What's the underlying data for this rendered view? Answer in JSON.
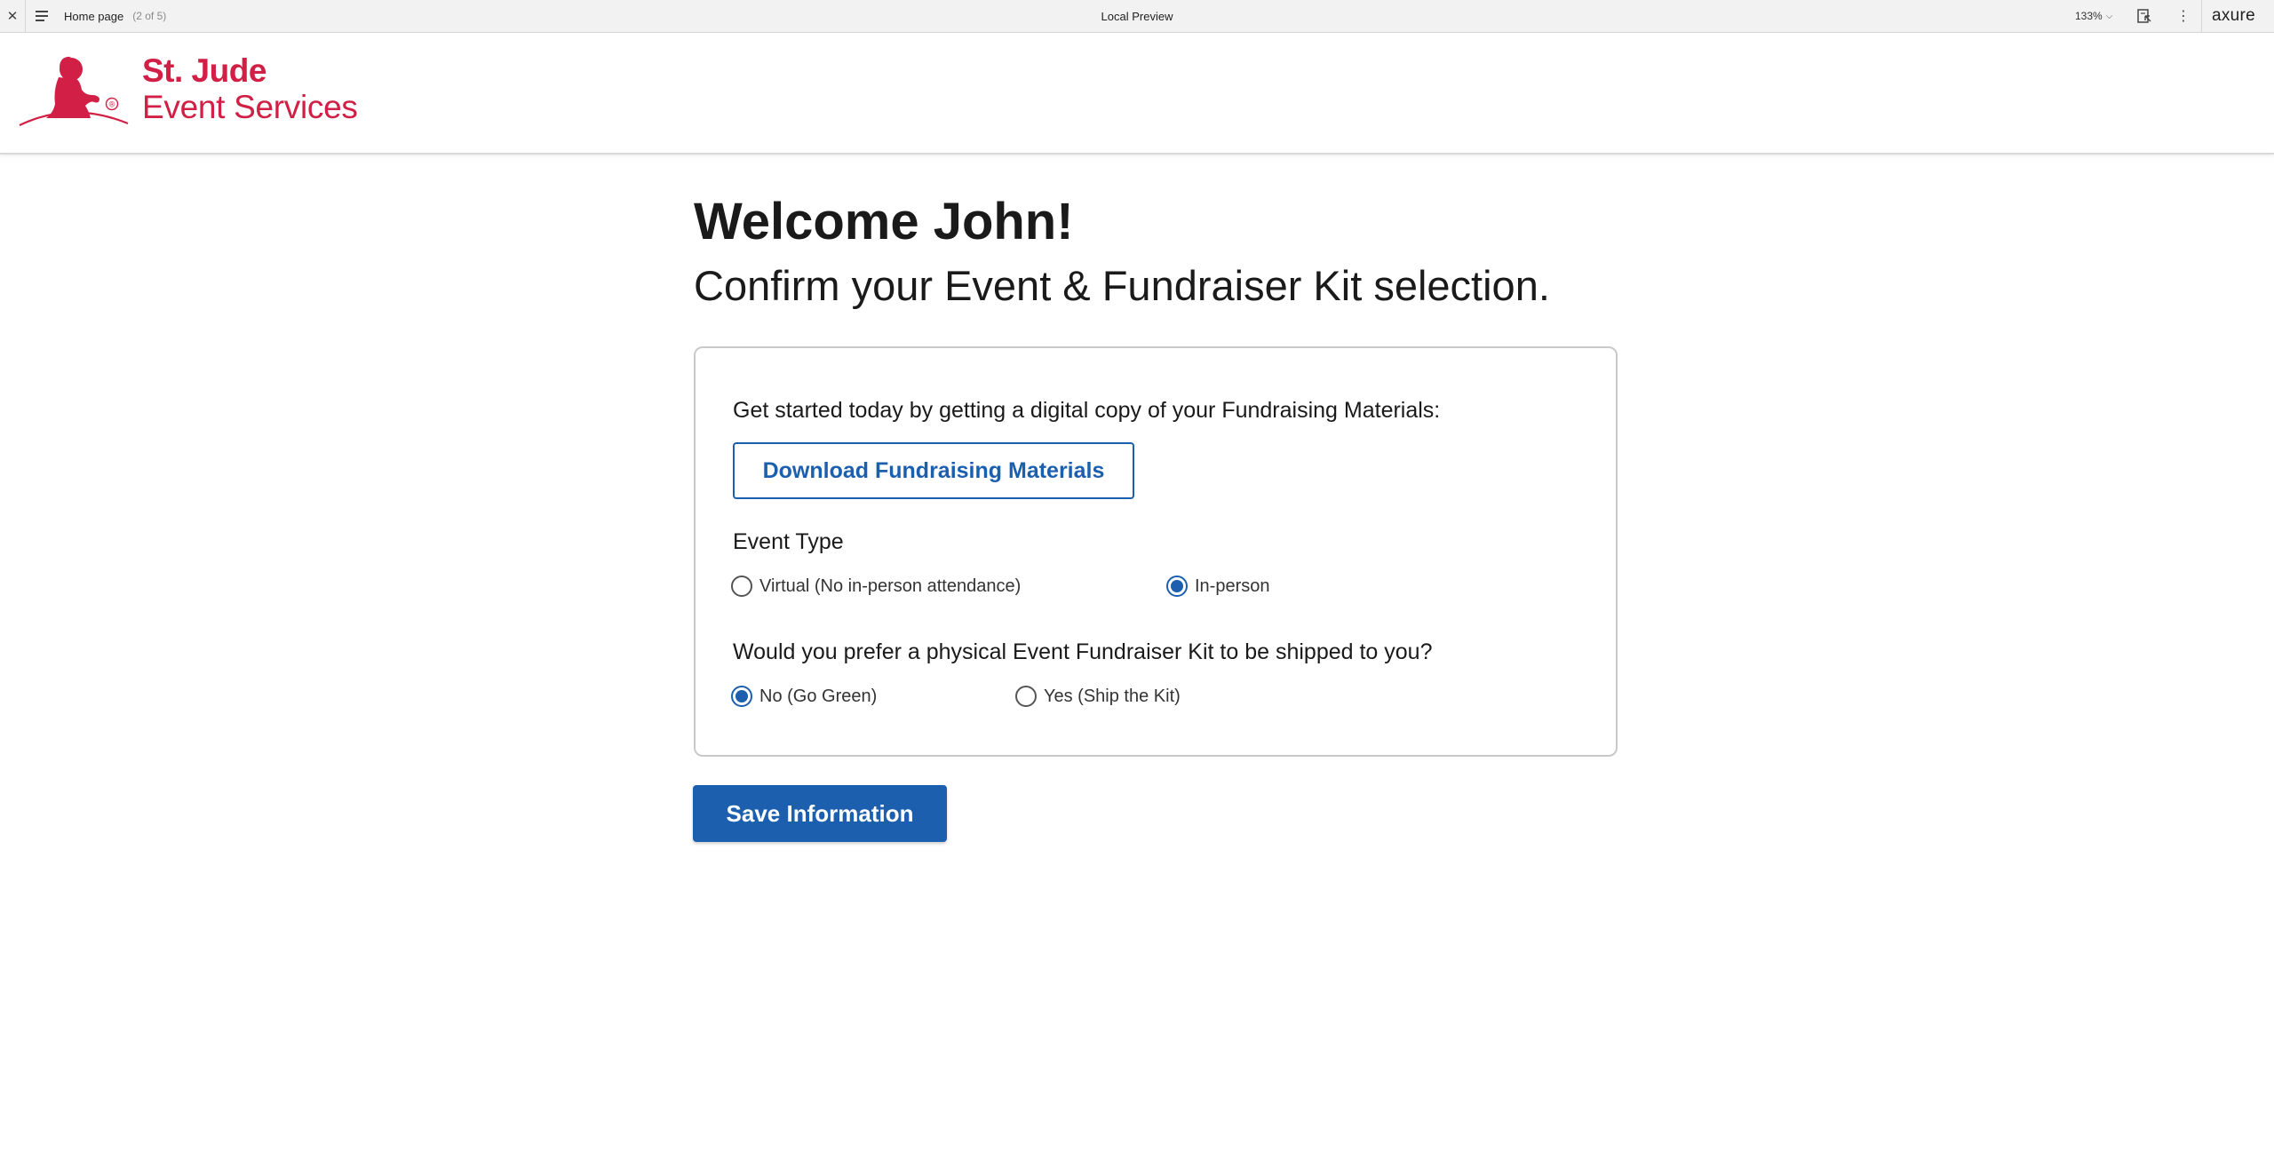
{
  "toolbar": {
    "close_glyph": "✕",
    "page_name": "Home page",
    "page_count": "(2 of 5)",
    "title": "Local Preview",
    "zoom": "133%",
    "zoom_chevron": "⌵",
    "more_glyph": "⋮",
    "brand": "axure",
    "icons": [
      "close-icon",
      "hamburger-menu-icon",
      "chevron-down-icon",
      "inspect-icon",
      "more-vertical-icon"
    ]
  },
  "header": {
    "logo_line1": "St. Jude",
    "logo_line2": "Event Services",
    "logo_registered": "®",
    "brand_color": "#d11f45"
  },
  "main": {
    "welcome": "Welcome John!",
    "subtitle": "Confirm your Event & Fundraiser Kit selection.",
    "card": {
      "intro": "Get started today by getting a digital copy of your Fundraising Materials:",
      "download_label": "Download Fundraising Materials",
      "event_type": {
        "label": "Event Type",
        "options": [
          {
            "label": "Virtual (No in-person attendance)",
            "checked": false
          },
          {
            "label": "In-person",
            "checked": true
          }
        ]
      },
      "kit": {
        "label": "Would you prefer a physical Event Fundraiser Kit to be shipped to you?",
        "options": [
          {
            "label": "No (Go Green)",
            "checked": true
          },
          {
            "label": "Yes (Ship the Kit)",
            "checked": false
          }
        ]
      }
    },
    "save_label": "Save Information"
  },
  "colors": {
    "accent_blue": "#1c5fae",
    "toolbar_bg": "#f2f2f2"
  }
}
